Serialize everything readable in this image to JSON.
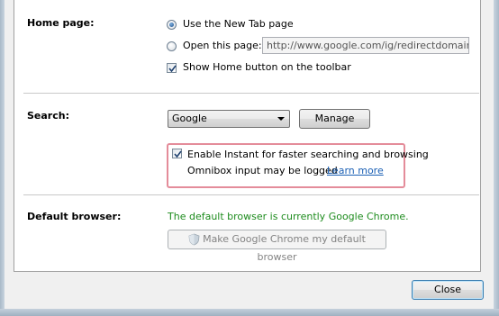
{
  "home_page": {
    "label": "Home page:",
    "option_new_tab": "Use the New Tab page",
    "option_open_page": "Open this page:",
    "url_value": "http://www.google.com/ig/redirectdomain?l",
    "show_home_button": "Show Home button on the toolbar"
  },
  "search": {
    "label": "Search:",
    "engine_selected": "Google",
    "manage_button": "Manage",
    "instant_checkbox": "Enable Instant for faster searching and browsing",
    "omnibox_note": "Omnibox input may be logged",
    "learn_more": "Learn more"
  },
  "default_browser": {
    "label": "Default browser:",
    "status": "The default browser is currently Google Chrome.",
    "make_default_button": "Make Google Chrome my default browser"
  },
  "footer": {
    "close_button": "Close"
  },
  "colors": {
    "status_green": "#1e8c1e",
    "link_blue": "#1a5fb4",
    "highlight_border": "#e48c9a"
  }
}
